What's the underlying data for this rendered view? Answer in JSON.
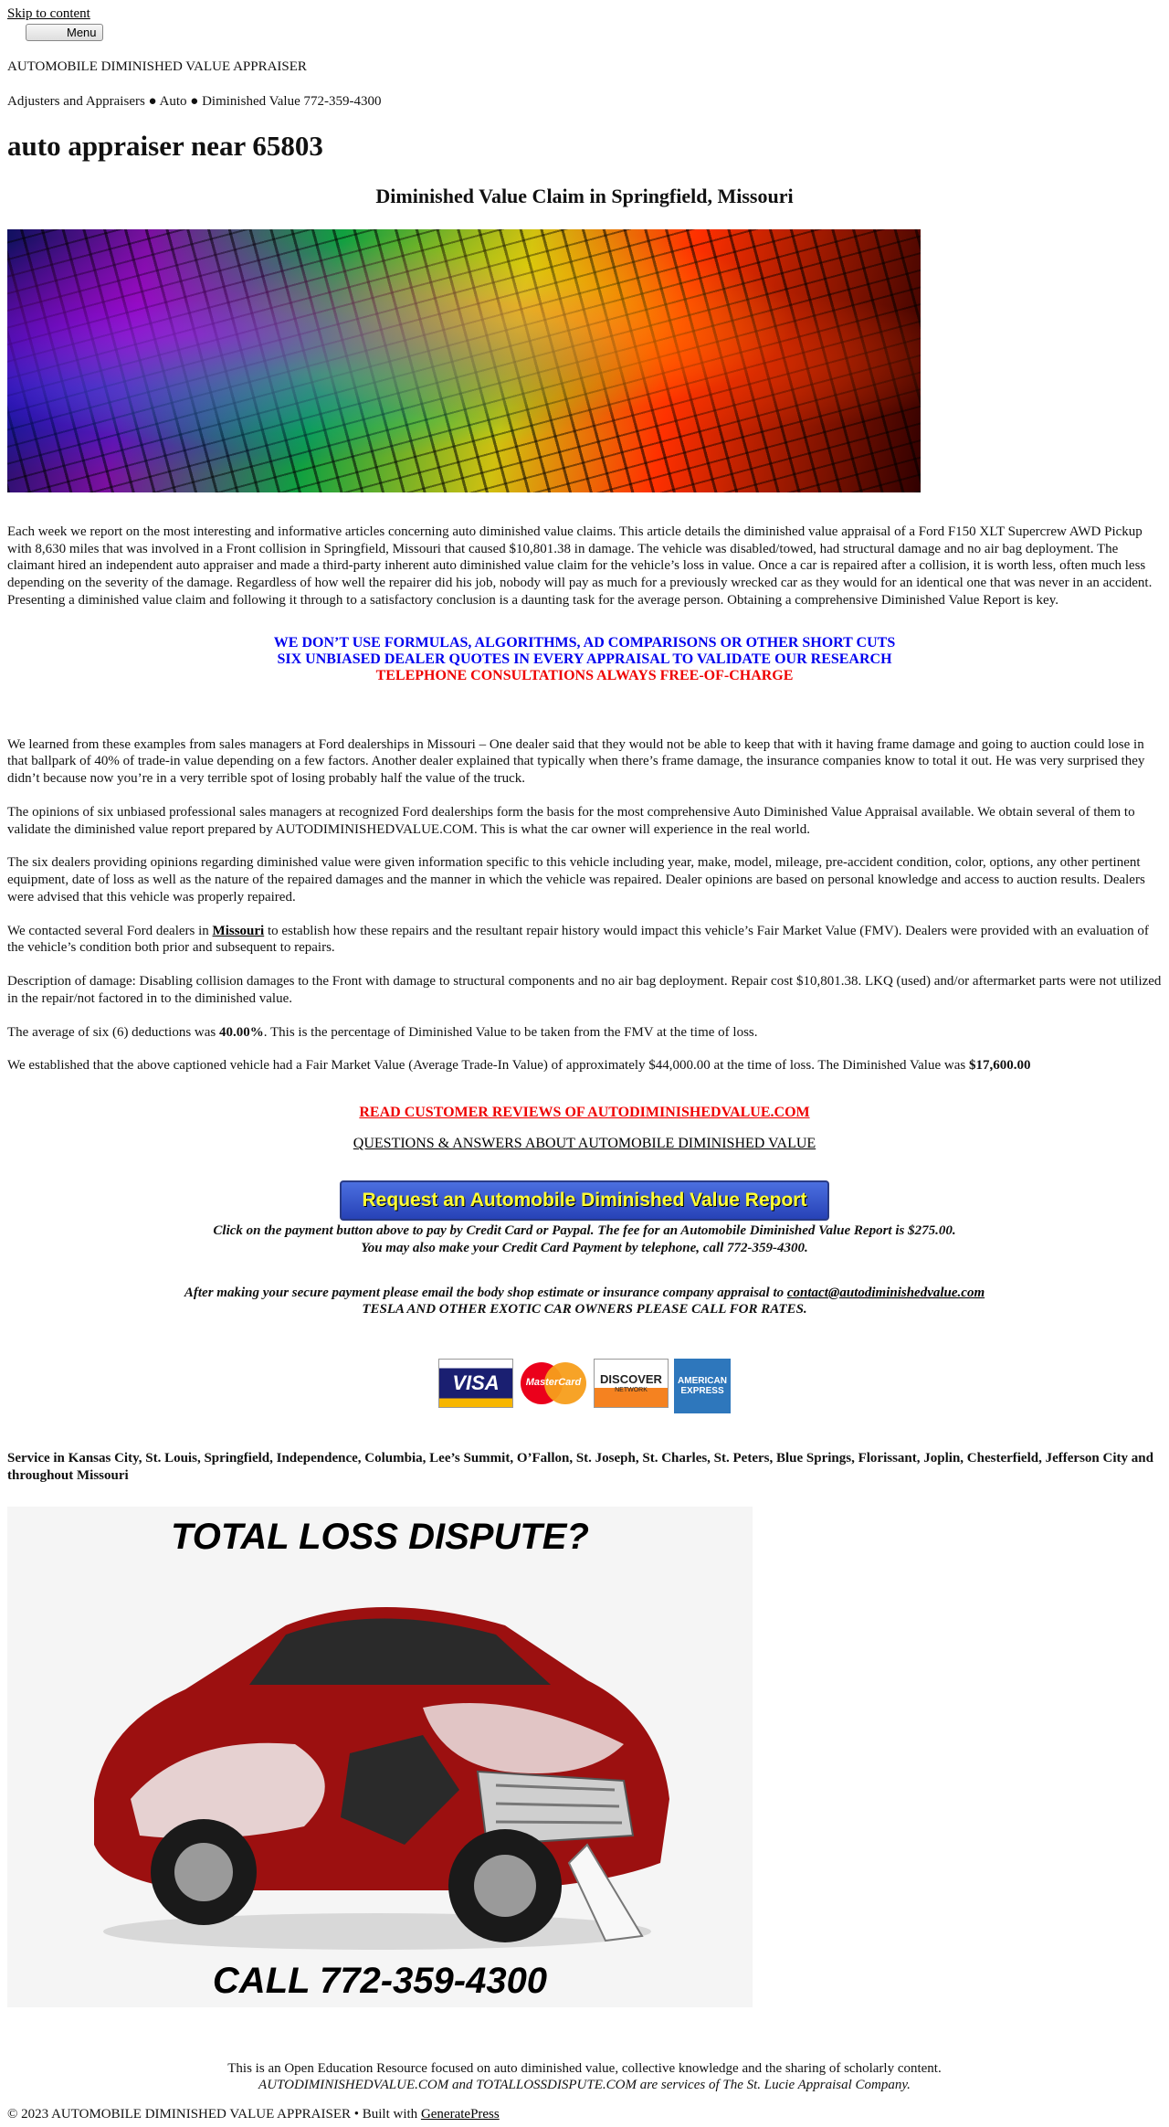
{
  "nav": {
    "skip_link": "Skip to content",
    "menu_label": "Menu"
  },
  "site": {
    "title": "AUTOMOBILE DIMINISHED VALUE APPRAISER",
    "tagline": "Adjusters and Appraisers ● Auto ● Diminished Value 772-359-4300"
  },
  "page": {
    "title": "auto appraiser near 65803",
    "subtitle": "Diminished Value Claim in Springfield, Missouri"
  },
  "intro": "Each week we report on the most interesting and informative articles concerning auto diminished value claims. This article details the diminished value appraisal of a Ford F150 XLT Supercrew AWD Pickup with 8,630 miles that was involved in a Front collision in Springfield, Missouri that caused $10,801.38 in damage. The vehicle was disabled/towed, had structural damage and no air bag deployment. The claimant hired an independent auto appraiser and made a third-party inherent auto diminished value claim for the vehicle’s loss in value. Once a car is repaired after a collision, it is worth less, often much less depending on the severity of the damage. Regardless of how well the repairer did his job, nobody will pay as much for a previously wrecked car as they would for an identical one that was never in an accident. Presenting a diminished value claim and following it through to a satisfactory conclusion is a daunting task for the average person. Obtaining a comprehensive Diminished Value Report is key.",
  "banner": {
    "line1": "WE DON’T USE FORMULAS, ALGORITHMS, AD COMPARISONS OR OTHER SHORT CUTS",
    "line2": "SIX UNBIASED DEALER QUOTES IN EVERY APPRAISAL TO VALIDATE OUR RESEARCH",
    "line3": "TELEPHONE CONSULTATIONS ALWAYS FREE-OF-CHARGE",
    "blue": "#0000ee",
    "red": "#ee0000"
  },
  "body": {
    "p1": "We learned from these examples from sales managers at Ford dealerships in Missouri – One dealer said that they would not be able to keep that with it having frame damage and going to auction could lose in that ballpark of 40% of trade-in value depending on a few factors. Another dealer explained that typically when there’s frame damage, the insurance companies know to total it out. He was very surprised they didn’t because now you’re in a very terrible spot of losing probably half the value of the truck.",
    "p2": "The opinions of six unbiased professional sales managers at recognized Ford dealerships form the basis for the most comprehensive Auto Diminished Value Appraisal available. We obtain several of them to validate the diminished value report prepared by AUTODIMINISHEDVALUE.COM. This is what the car owner will experience in the real world.",
    "p3": "The six dealers providing opinions regarding diminished value were given information specific to this vehicle including year, make, model, mileage, pre-accident condition, color, options, any other pertinent equipment, date of loss as well as the nature of the repaired damages and the manner in which the vehicle was repaired. Dealer opinions are based on personal knowledge and access to auction results. Dealers were advised that this vehicle was properly repaired.",
    "p4_before": "We contacted several Ford dealers in ",
    "p4_link": "Missouri",
    "p4_after": " to establish how these repairs and the resultant repair history would impact this vehicle’s Fair Market Value (FMV). Dealers were provided with an evaluation of the vehicle’s condition both prior and subsequent to repairs.",
    "p5": "Description of damage: Disabling collision damages to the Front with damage to structural components and no air bag deployment. Repair cost $10,801.38. LKQ (used) and/or aftermarket parts were not utilized in the repair/not factored in to the diminished value.",
    "p6_before": "The average of six (6) deductions was ",
    "p6_bold": "40.00%",
    "p6_after": ". This is the percentage of Diminished Value to be taken from the FMV at the time of loss.",
    "p7_before": "We established that the above captioned vehicle had a Fair Market Value (Average Trade-In Value) of approximately $44,000.00 at the time of loss. The Diminished Value was ",
    "p7_bold": "$17,600.00"
  },
  "links": {
    "reviews": "READ CUSTOMER REVIEWS OF AUTODIMINISHEDVALUE.COM",
    "qa": "QUESTIONS & ANSWERS ABOUT AUTOMOBILE DIMINISHED VALUE"
  },
  "payment": {
    "button_label": "Request an Automobile Diminished Value Report",
    "note": "Click on the payment button above to pay by Credit Card or Paypal. The fee for an Automobile Diminished Value Report is $275.00. You may also make your Credit Card Payment by telephone, call 772-359-4300.",
    "after_before": "After making your secure payment please email the body shop estimate or insurance company appraisal to ",
    "email": "contact@autodiminishedvalue.com",
    "tesla": "TESLA AND OTHER EXOTIC CAR OWNERS PLEASE CALL FOR RATES.",
    "cards": {
      "visa": "VISA",
      "mastercard": "MasterCard",
      "discover": "DISCOVER",
      "discover_sub": "NETWORK",
      "amex_line1": "AMERICAN",
      "amex_line2": "EXPRESS"
    }
  },
  "service_area": "Service in Kansas City, St. Louis, Springfield, Independence, Columbia, Lee’s Summit, O’Fallon, St. Joseph, St. Charles, St. Peters, Blue Springs, Florissant, Joplin, Chesterfield, Jefferson City and throughout Missouri",
  "total_loss_ad": {
    "headline": "TOTAL LOSS DISPUTE?",
    "call": "CALL 772-359-4300",
    "icon": "wrecked-car-icon"
  },
  "footer": {
    "line1": "This is an Open Education Resource focused on auto diminished value, collective knowledge and the sharing of scholarly content.",
    "line2": "AUTODIMINISHEDVALUE.COM and TOTALLOSSDISPUTE.COM are services of The St. Lucie Appraisal Company.",
    "copyright_before": "© 2023 AUTOMOBILE DIMINISHED VALUE APPRAISER • Built with ",
    "generatepress": "GeneratePress"
  }
}
